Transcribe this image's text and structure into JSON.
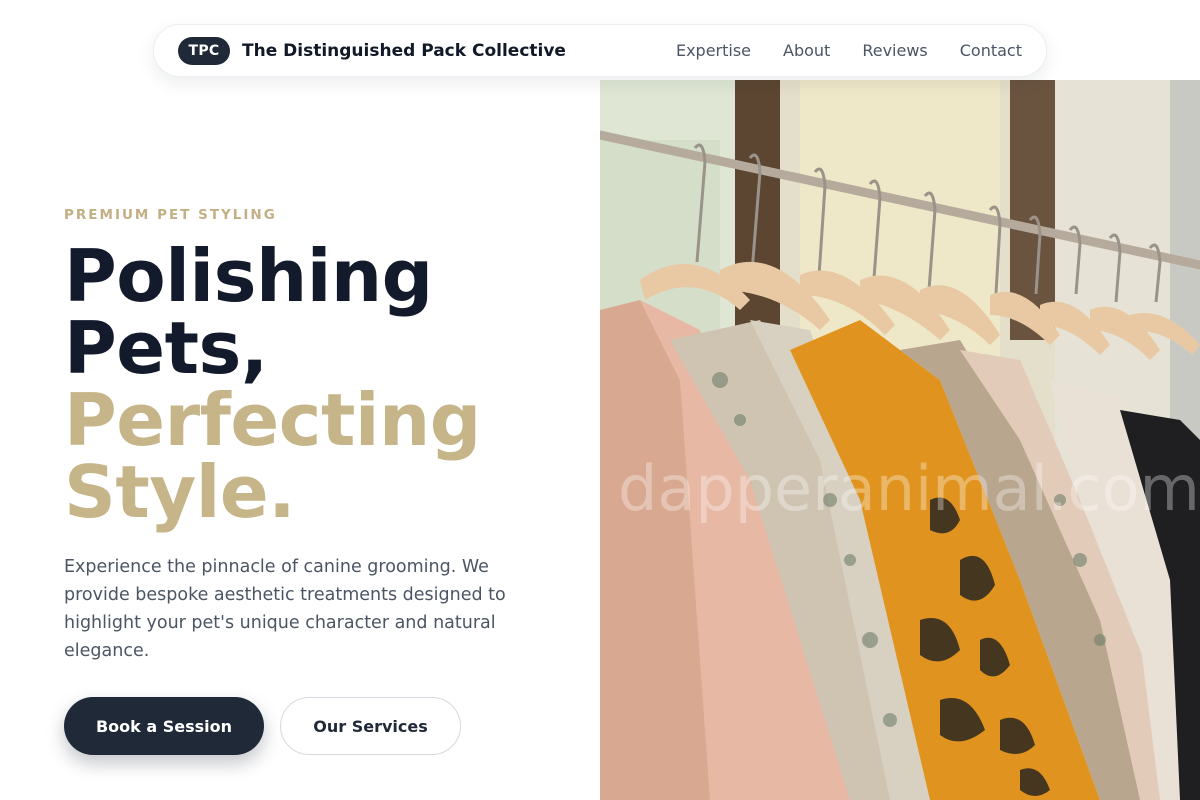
{
  "nav": {
    "logo_badge": "TPC",
    "brand_name": "The Distinguished Pack Collective",
    "links": [
      "Expertise",
      "About",
      "Reviews",
      "Contact"
    ]
  },
  "hero": {
    "eyebrow": "PREMIUM PET STYLING",
    "headline_line1": "Polishing",
    "headline_line2": "Pets,",
    "headline_line3": "Perfecting",
    "headline_line4": "Style.",
    "lead": "Experience the pinnacle of canine grooming. We provide bespoke aesthetic treatments designed to highlight your pet's unique character and natural elegance.",
    "primary_cta": "Book a Session",
    "secondary_cta": "Our Services",
    "image_watermark": "dapperanimal.com"
  },
  "colors": {
    "navy": "#1f2937",
    "gold": "#c6b588",
    "text_muted": "#4b5563"
  }
}
